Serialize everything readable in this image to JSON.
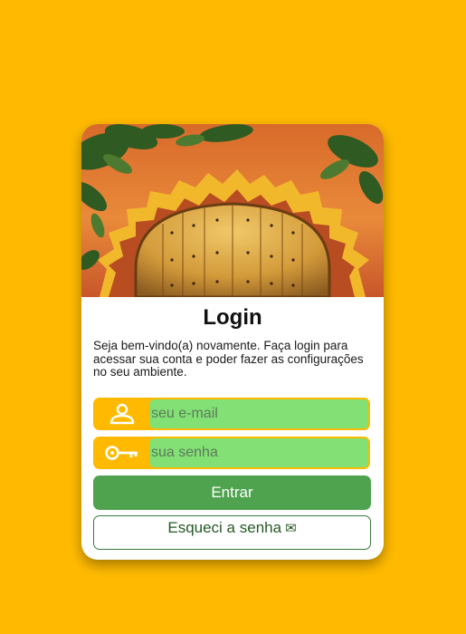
{
  "colors": {
    "background": "#FFBA00",
    "field_accent": "#FFBA00",
    "field_fill": "#83E075",
    "primary_button": "#4FA34F"
  },
  "login": {
    "hero_image": "ornate-yellow-door-photo",
    "title": "Login",
    "description": "Seja bem-vindo(a) novamente. Faça login para acessar sua conta e poder fazer as configurações no seu ambiente.",
    "email": {
      "icon": "user-icon",
      "placeholder": "seu e-mail",
      "value": ""
    },
    "password": {
      "icon": "key-icon",
      "placeholder": "sua senha",
      "value": ""
    },
    "submit_label": "Entrar",
    "forgot_label": "Esqueci a senha",
    "forgot_icon": "mail-icon"
  }
}
